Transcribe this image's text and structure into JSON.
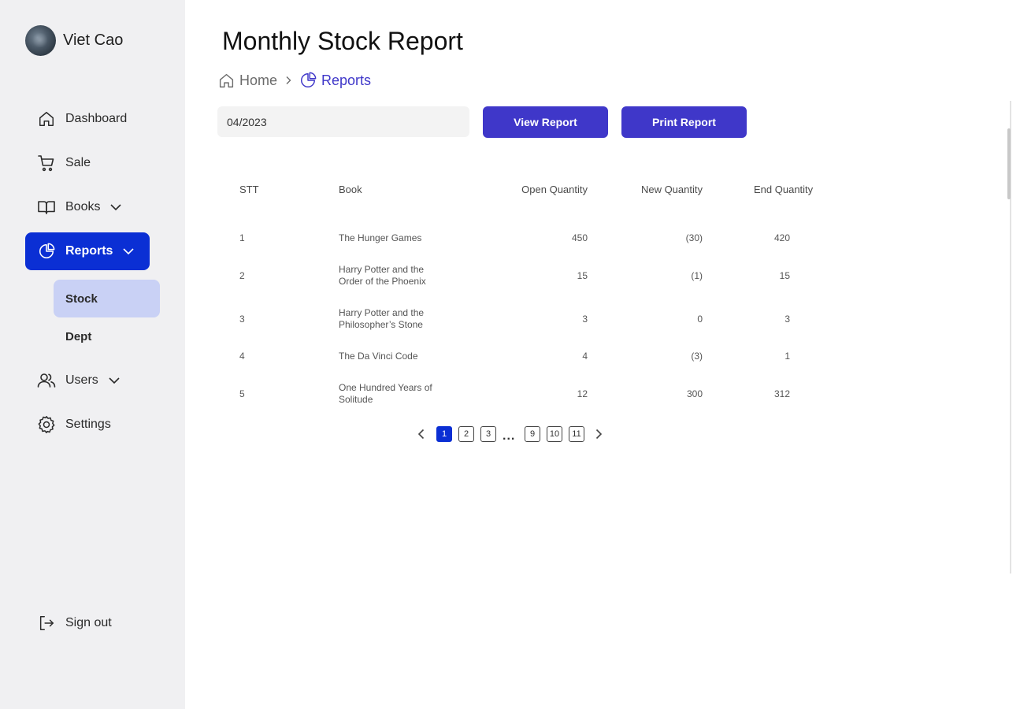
{
  "user": {
    "name": "Viet Cao"
  },
  "sidebar": {
    "items": [
      {
        "label": "Dashboard",
        "icon": "home-icon"
      },
      {
        "label": "Sale",
        "icon": "cart-icon"
      },
      {
        "label": "Books",
        "icon": "book-icon"
      },
      {
        "label": "Reports",
        "icon": "pie-chart-icon"
      },
      {
        "label": "Users",
        "icon": "users-icon"
      },
      {
        "label": "Settings",
        "icon": "gear-icon"
      }
    ],
    "sub_items": [
      {
        "label": "Stock"
      },
      {
        "label": "Dept"
      }
    ],
    "sign_out": "Sign out",
    "active_color": "#0b2fd4",
    "active_sub_color": "#c9d1f5"
  },
  "page": {
    "title": "Monthly Stock Report",
    "breadcrumb": {
      "home": "Home",
      "current": "Reports"
    }
  },
  "filters": {
    "month_value": "04/2023"
  },
  "actions": {
    "view": "View Report",
    "print": "Print Report",
    "button_color": "#3f37c9"
  },
  "table": {
    "headers": {
      "stt": "STT",
      "book": "Book",
      "open": "Open Quantity",
      "new": "New Quantity",
      "end": "End Quantity"
    },
    "rows": [
      {
        "stt": "1",
        "book": "The Hunger Games",
        "open": "450",
        "new": "(30)",
        "end": "420"
      },
      {
        "stt": "2",
        "book": "Harry Potter and the Order of the Phoenix",
        "open": "15",
        "new": "(1)",
        "end": "15"
      },
      {
        "stt": "3",
        "book": "Harry Potter and the Philosopher’s Stone",
        "open": "3",
        "new": "0",
        "end": "3"
      },
      {
        "stt": "4",
        "book": "The Da Vinci Code",
        "open": "4",
        "new": "(3)",
        "end": "1"
      },
      {
        "stt": "5",
        "book": "One Hundred Years of Solitude",
        "open": "12",
        "new": "300",
        "end": "312"
      }
    ]
  },
  "pagination": {
    "pages": [
      "1",
      "2",
      "3",
      "9",
      "10",
      "11"
    ],
    "ellipsis": "...",
    "current": "1"
  }
}
